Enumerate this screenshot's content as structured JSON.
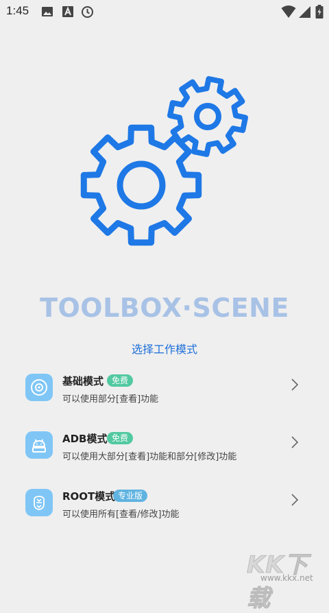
{
  "status_bar": {
    "time": "1:45",
    "left_icons": [
      "image-icon",
      "font-a-icon",
      "clock-icon"
    ],
    "right_icons": [
      "wifi-icon",
      "signal-icon",
      "battery-charging-icon"
    ]
  },
  "app": {
    "title": "TOOLBOX·SCENE",
    "subtitle": "选择工作模式",
    "gear_color": "#1e78e6"
  },
  "modes": [
    {
      "title": "基础模式",
      "badge": "免费",
      "badge_type": "free",
      "description": "可以使用部分[查看]功能",
      "icon": "disc-icon"
    },
    {
      "title": "ADB模式",
      "badge": "免费",
      "badge_type": "free",
      "description": "可以使用大部分[查看]功能和部分[修改]功能",
      "icon": "android-icon"
    },
    {
      "title": "ROOT模式",
      "badge": "专业版",
      "badge_type": "pro",
      "description": "可以使用所有[查看/修改]功能",
      "icon": "chip-icon"
    }
  ],
  "watermark": {
    "text": "KK下载",
    "url": "www.kkx.net"
  }
}
